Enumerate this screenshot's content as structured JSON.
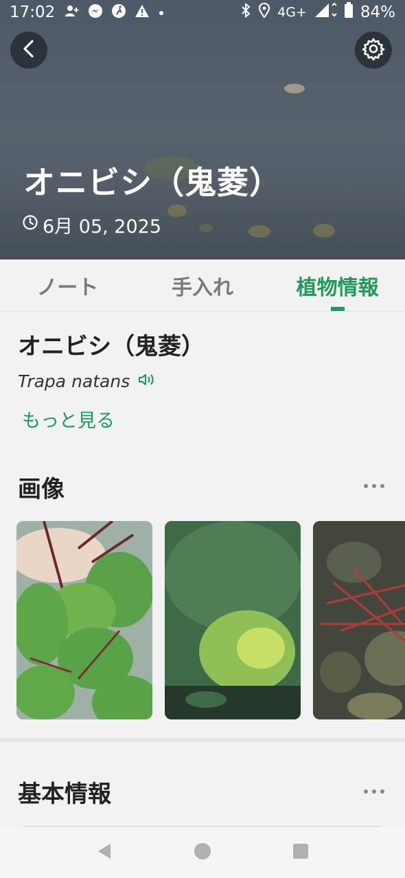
{
  "status_bar": {
    "time": "17:02",
    "network": "4G+",
    "battery": "84%"
  },
  "hero": {
    "title": "オニビシ（鬼菱）",
    "date": "6月 05, 2025"
  },
  "tabs": [
    {
      "label": "ノート",
      "active": false
    },
    {
      "label": "手入れ",
      "active": false
    },
    {
      "label": "植物情報",
      "active": true
    }
  ],
  "plant": {
    "name": "オニビシ（鬼菱）",
    "scientific_name": "Trapa natans",
    "more_link": "もっと見る"
  },
  "images_section": {
    "title": "画像"
  },
  "basic_info_section": {
    "title": "基本情報"
  },
  "colors": {
    "accent": "#1e9a5a",
    "hero_water": "#56616c"
  }
}
